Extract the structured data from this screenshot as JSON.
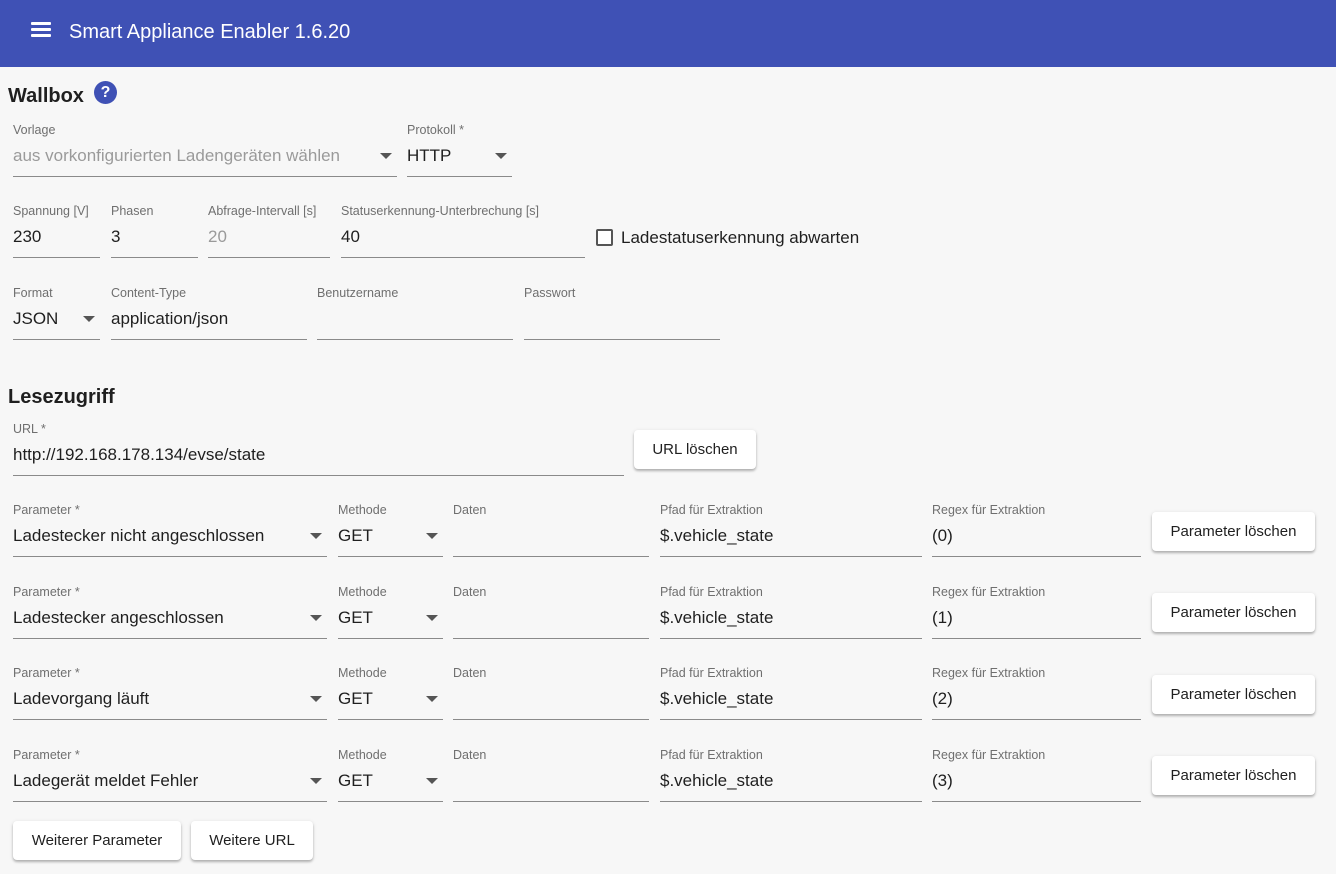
{
  "toolbar": {
    "title": "Smart Appliance Enabler 1.6.20",
    "menu_icon": "menu-icon"
  },
  "wallbox": {
    "heading": "Wallbox",
    "help_glyph": "?",
    "vorlage": {
      "label": "Vorlage",
      "value": "aus vorkonfigurierten Ladengeräten wählen"
    },
    "protokoll": {
      "label": "Protokoll *",
      "value": "HTTP"
    },
    "spannung": {
      "label": "Spannung [V]",
      "value": "230"
    },
    "phasen": {
      "label": "Phasen",
      "value": "3"
    },
    "abfrage": {
      "label": "Abfrage-Intervall [s]",
      "value": "20"
    },
    "status_unterbrechung": {
      "label": "Statuserkennung-Unterbrechung [s]",
      "value": "40"
    },
    "ladestatus_checkbox": {
      "label": "Ladestatuserkennung abwarten",
      "checked": false
    },
    "format": {
      "label": "Format",
      "value": "JSON"
    },
    "content_type": {
      "label": "Content-Type",
      "value": "application/json"
    },
    "benutzername": {
      "label": "Benutzername",
      "value": ""
    },
    "passwort": {
      "label": "Passwort",
      "value": ""
    }
  },
  "lesezugriff": {
    "heading": "Lesezugriff",
    "url": {
      "label": "URL *",
      "value": "http://192.168.178.134/evse/state"
    },
    "url_delete_label": "URL löschen",
    "parameter_label": "Parameter *",
    "methode_label": "Methode",
    "daten_label": "Daten",
    "pfad_label": "Pfad für Extraktion",
    "regex_label": "Regex für Extraktion",
    "delete_param_label": "Parameter löschen",
    "rows": [
      {
        "parameter": "Ladestecker nicht angeschlossen",
        "methode": "GET",
        "daten": "",
        "pfad": "$.vehicle_state",
        "regex": "(0)"
      },
      {
        "parameter": "Ladestecker angeschlossen",
        "methode": "GET",
        "daten": "",
        "pfad": "$.vehicle_state",
        "regex": "(1)"
      },
      {
        "parameter": "Ladevorgang läuft",
        "methode": "GET",
        "daten": "",
        "pfad": "$.vehicle_state",
        "regex": "(2)"
      },
      {
        "parameter": "Ladegerät meldet Fehler",
        "methode": "GET",
        "daten": "",
        "pfad": "$.vehicle_state",
        "regex": "(3)"
      }
    ],
    "add_param_label": "Weiterer Parameter",
    "add_url_label": "Weitere URL"
  },
  "colors": {
    "primary": "#3f51b5",
    "background": "#f7f7f7"
  }
}
